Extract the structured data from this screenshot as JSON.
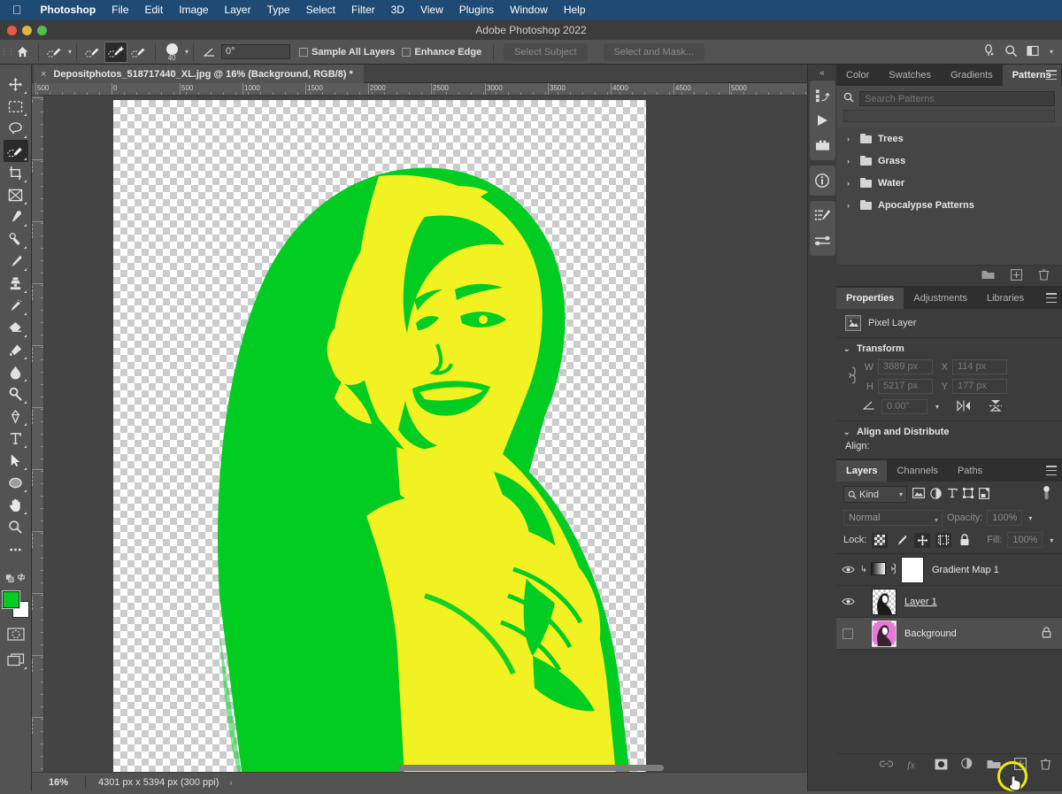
{
  "os_menu": {
    "apple": "apple-logo",
    "items": [
      "Photoshop",
      "File",
      "Edit",
      "Image",
      "Layer",
      "Type",
      "Select",
      "Filter",
      "3D",
      "View",
      "Plugins",
      "Window",
      "Help"
    ]
  },
  "window": {
    "title": "Adobe Photoshop 2022"
  },
  "options_bar": {
    "home_icon": "home-icon",
    "tool_preset": "quick-selection-preset",
    "mode_new": "selection-new-icon",
    "mode_add": "selection-add-icon",
    "mode_subtract": "selection-subtract-icon",
    "brush_size": "40",
    "angle_label": "angle-icon",
    "angle_value": "0°",
    "sample_all_layers": "Sample All Layers",
    "enhance_edge": "Enhance Edge",
    "select_subject": "Select Subject",
    "select_and_mask": "Select and Mask...",
    "right_icons": [
      "workspace-search-icon",
      "search-icon",
      "arrange-documents-icon"
    ]
  },
  "toolbar": {
    "tools": [
      {
        "name": "move-tool"
      },
      {
        "name": "marquee-tool"
      },
      {
        "name": "lasso-tool"
      },
      {
        "name": "quick-selection-tool",
        "selected": true
      },
      {
        "name": "crop-tool"
      },
      {
        "name": "frame-tool"
      },
      {
        "name": "eyedropper-tool"
      },
      {
        "name": "healing-brush-tool"
      },
      {
        "name": "brush-tool"
      },
      {
        "name": "clone-stamp-tool"
      },
      {
        "name": "history-brush-tool"
      },
      {
        "name": "eraser-tool"
      },
      {
        "name": "gradient-tool"
      },
      {
        "name": "blur-tool"
      },
      {
        "name": "dodge-tool"
      },
      {
        "name": "pen-tool"
      },
      {
        "name": "type-tool"
      },
      {
        "name": "path-selection-tool"
      },
      {
        "name": "ellipse-tool"
      },
      {
        "name": "hand-tool"
      },
      {
        "name": "zoom-tool"
      },
      {
        "name": "edit-toolbar-tool"
      }
    ],
    "foreground_color": "#00cc22",
    "background_color": "#ffffff",
    "quick_mask": "quick-mask-icon",
    "screen_mode": "screen-mode-icon"
  },
  "document": {
    "tab_title": "Depositphotos_518717440_XL.jpg @ 16% (Background, RGB/8) *",
    "close": "×",
    "ruler_h": [
      "500",
      "0",
      "500",
      "1000",
      "1500",
      "2000",
      "2500",
      "3000",
      "3500",
      "4000",
      "4500",
      "5000"
    ],
    "ruler_v": [
      "0",
      "500",
      "1000",
      "1500",
      "2000",
      "2500",
      "3000",
      "3500",
      "4000",
      "4500",
      "5000"
    ]
  },
  "status_bar": {
    "zoom": "16%",
    "dimensions": "4301 px x 5394 px (300 ppi)",
    "arrow": "›"
  },
  "rail": {
    "collapse": "«",
    "buttons": [
      "history-actions-icon",
      "play-icon",
      "library-icon",
      "info-icon",
      "brush-settings-icon",
      "adjustments-sliders-icon"
    ]
  },
  "patterns_panel": {
    "tabs": [
      {
        "label": "Color",
        "active": false
      },
      {
        "label": "Swatches",
        "active": false
      },
      {
        "label": "Gradients",
        "active": false
      },
      {
        "label": "Patterns",
        "active": true
      }
    ],
    "menu_icon": "panel-menu-icon",
    "search_icon": "search-icon",
    "search_placeholder": "Search Patterns",
    "groups": [
      "Trees",
      "Grass",
      "Water",
      "Apocalypse Patterns"
    ],
    "footer_icons": [
      "new-group-icon",
      "new-pattern-icon",
      "delete-icon"
    ]
  },
  "properties_panel": {
    "tabs": [
      {
        "label": "Properties",
        "active": true
      },
      {
        "label": "Adjustments",
        "active": false
      },
      {
        "label": "Libraries",
        "active": false
      }
    ],
    "menu_icon": "panel-menu-icon",
    "layer_kind_icon": "pixel-layer-icon",
    "layer_kind": "Pixel Layer",
    "transform": {
      "title": "Transform",
      "chevron": "⌄",
      "link_icon": "link-aspect-ratio-icon",
      "w_label": "W",
      "w_value": "3889 px",
      "h_label": "H",
      "h_value": "5217 px",
      "x_label": "X",
      "x_value": "114 px",
      "y_label": "Y",
      "y_value": "177 px",
      "angle_icon": "angle-icon",
      "angle_value": "0.00°",
      "flip_horizontal": "flip-horizontal-icon",
      "flip_vertical": "flip-vertical-icon"
    },
    "align": {
      "title": "Align and Distribute",
      "label": "Align:"
    }
  },
  "layers_panel": {
    "tabs": [
      {
        "label": "Layers",
        "active": true
      },
      {
        "label": "Channels",
        "active": false
      },
      {
        "label": "Paths",
        "active": false
      }
    ],
    "menu_icon": "panel-menu-icon",
    "filter": {
      "kind_label": "Kind",
      "search_icon": "search-icon",
      "chevron": "⌄",
      "filter_icons": [
        "filter-pixel-icon",
        "filter-adjustment-icon",
        "filter-type-icon",
        "filter-shape-icon",
        "filter-smart-object-icon"
      ],
      "toggle_icon": "filter-toggle-switch"
    },
    "blend_mode": "Normal",
    "opacity_label": "Opacity:",
    "opacity_value": "100%",
    "lock_label": "Lock:",
    "lock_icons": [
      "lock-transparent-pixels",
      "lock-image-pixels",
      "lock-position",
      "lock-artboard-nesting",
      "lock-all"
    ],
    "fill_label": "Fill:",
    "fill_value": "100%",
    "layers": [
      {
        "name": "Gradient Map 1",
        "visible": true,
        "selected": false,
        "kind": "adjustment",
        "locked": false
      },
      {
        "name": "Layer 1",
        "visible": true,
        "selected": false,
        "kind": "pixel",
        "locked": false
      },
      {
        "name": "Background",
        "visible": false,
        "selected": true,
        "kind": "pixel",
        "locked": true
      }
    ],
    "footer_icons": [
      "link-layers-icon",
      "layer-style-fx-icon",
      "add-layer-mask-icon",
      "new-adjustment-layer-icon",
      "new-group-icon",
      "new-layer-icon",
      "delete-layer-icon"
    ],
    "highlighted_button": "new-layer-icon"
  },
  "artwork": {
    "description": "posterized duotone portrait of a smiling woman with long hair on transparent background",
    "color_dark": "#00cc22",
    "color_light": "#f2f222"
  }
}
